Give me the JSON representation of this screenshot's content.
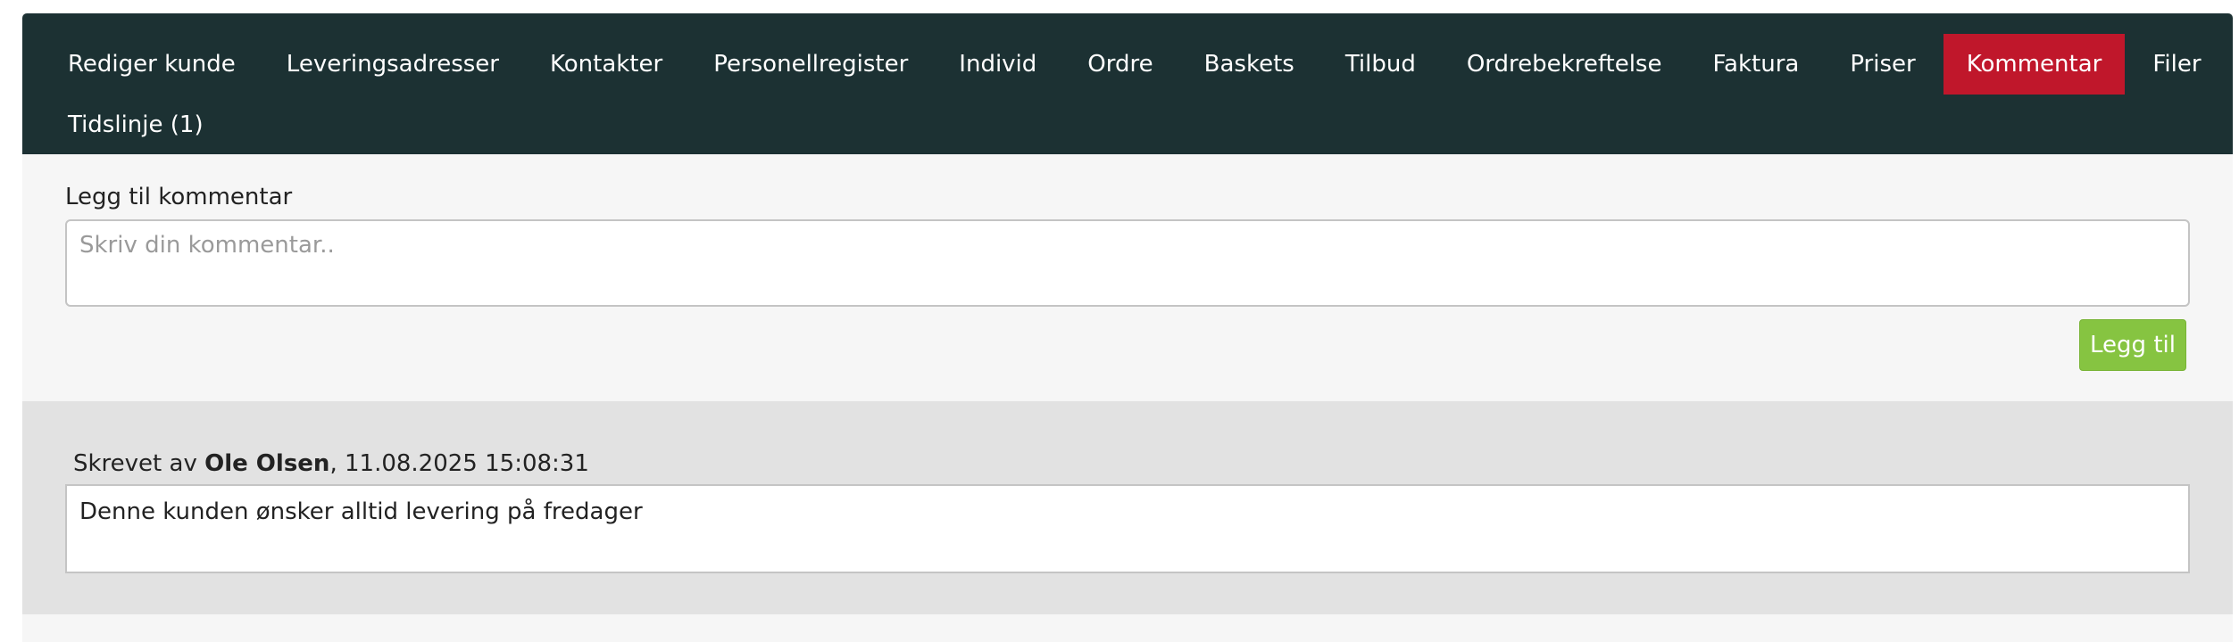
{
  "nav": {
    "items": [
      {
        "label": "Rediger kunde",
        "active": false
      },
      {
        "label": "Leveringsadresser",
        "active": false
      },
      {
        "label": "Kontakter",
        "active": false
      },
      {
        "label": "Personellregister",
        "active": false
      },
      {
        "label": "Individ",
        "active": false
      },
      {
        "label": "Ordre",
        "active": false
      },
      {
        "label": "Baskets",
        "active": false
      },
      {
        "label": "Tilbud",
        "active": false
      },
      {
        "label": "Ordrebekreftelse",
        "active": false
      },
      {
        "label": "Faktura",
        "active": false
      },
      {
        "label": "Priser",
        "active": false
      },
      {
        "label": "Kommentar",
        "active": true
      },
      {
        "label": "Filer",
        "active": false
      },
      {
        "label": "Tidslinje (1)",
        "active": false
      }
    ]
  },
  "add_comment": {
    "label": "Legg til kommentar",
    "placeholder": "Skriv din kommentar..",
    "value": "",
    "button_label": "Legg til"
  },
  "comments": [
    {
      "prefix": "Skrevet av ",
      "author": "Ole Olsen",
      "timestamp": ", 11.08.2025 15:08:31",
      "text": "Denne kunden ønsker alltid levering på fredager"
    }
  ],
  "colors": {
    "navbar_bg": "#1c3133",
    "active_tab": "#c0172b",
    "add_button": "#86c441",
    "panel_bg": "#f6f6f6",
    "comment_block_bg": "#e2e2e2"
  }
}
